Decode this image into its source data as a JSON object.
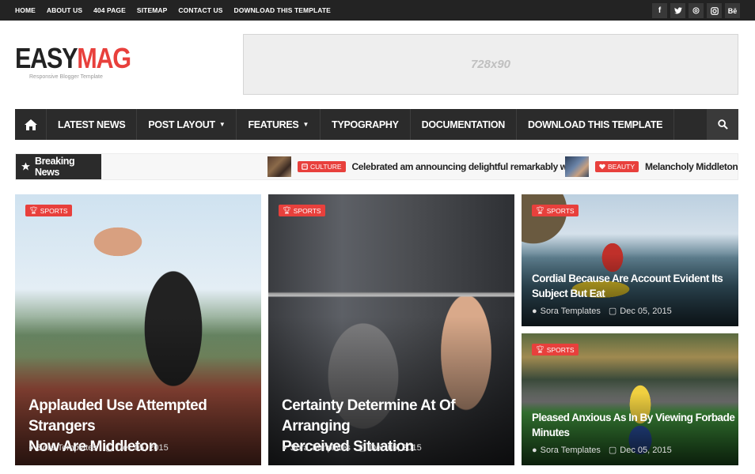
{
  "topnav": {
    "items": [
      "HOME",
      "ABOUT US",
      "404 PAGE",
      "SITEMAP",
      "CONTACT US",
      "DOWNLOAD THIS TEMPLATE"
    ]
  },
  "social": {
    "items": [
      {
        "icon": "facebook-icon",
        "glyph": "f"
      },
      {
        "icon": "twitter-icon",
        "glyph": "t"
      },
      {
        "icon": "dribbble-icon",
        "glyph": "◎"
      },
      {
        "icon": "instagram-icon",
        "glyph": "▣"
      },
      {
        "icon": "behance-icon",
        "glyph": "Bē"
      }
    ]
  },
  "header": {
    "logo_part1": "EASY",
    "logo_part2": "MAG",
    "tagline": "Responsive Blogger Template",
    "ad_text": "728x90"
  },
  "mainnav": {
    "items": [
      {
        "label": "LATEST NEWS",
        "dropdown": false
      },
      {
        "label": "POST LAYOUT",
        "dropdown": true
      },
      {
        "label": "FEATURES",
        "dropdown": true
      },
      {
        "label": "TYPOGRAPHY",
        "dropdown": false
      },
      {
        "label": "DOCUMENTATION",
        "dropdown": false
      },
      {
        "label": "DOWNLOAD THIS TEMPLATE",
        "dropdown": false
      }
    ]
  },
  "breaking": {
    "label": "Breaking News",
    "items": [
      {
        "tag": "CULTURE",
        "title": "Celebrated am announcing delightful remarkably we"
      },
      {
        "tag": "BEAUTY",
        "title": "Melancholy Middletons Yet"
      }
    ]
  },
  "posts": [
    {
      "tag": "SPORTS",
      "title_line1": "Applauded Use Attempted Strangers",
      "title_line2": "Now Are Middleton",
      "author": "Sora Templates",
      "date": "Dec 05, 2015"
    },
    {
      "tag": "SPORTS",
      "title_line1": "Certainty Determine At Of Arranging",
      "title_line2": "Perceived Situation",
      "author": "Sora Templates",
      "date": "Dec 05, 2015"
    },
    {
      "tag": "SPORTS",
      "title_line1": "Cordial Because Are Account Evident Its",
      "title_line2": "Subject But Eat",
      "author": "Sora Templates",
      "date": "Dec 05, 2015"
    },
    {
      "tag": "SPORTS",
      "title_line1": "Pleased Anxious As In By Viewing Forbade",
      "title_line2": "Minutes",
      "author": "Sora Templates",
      "date": "Dec 05, 2015"
    }
  ],
  "colors": {
    "accent": "#e8403c",
    "dark": "#2b2b2b",
    "topbar": "#232323"
  }
}
